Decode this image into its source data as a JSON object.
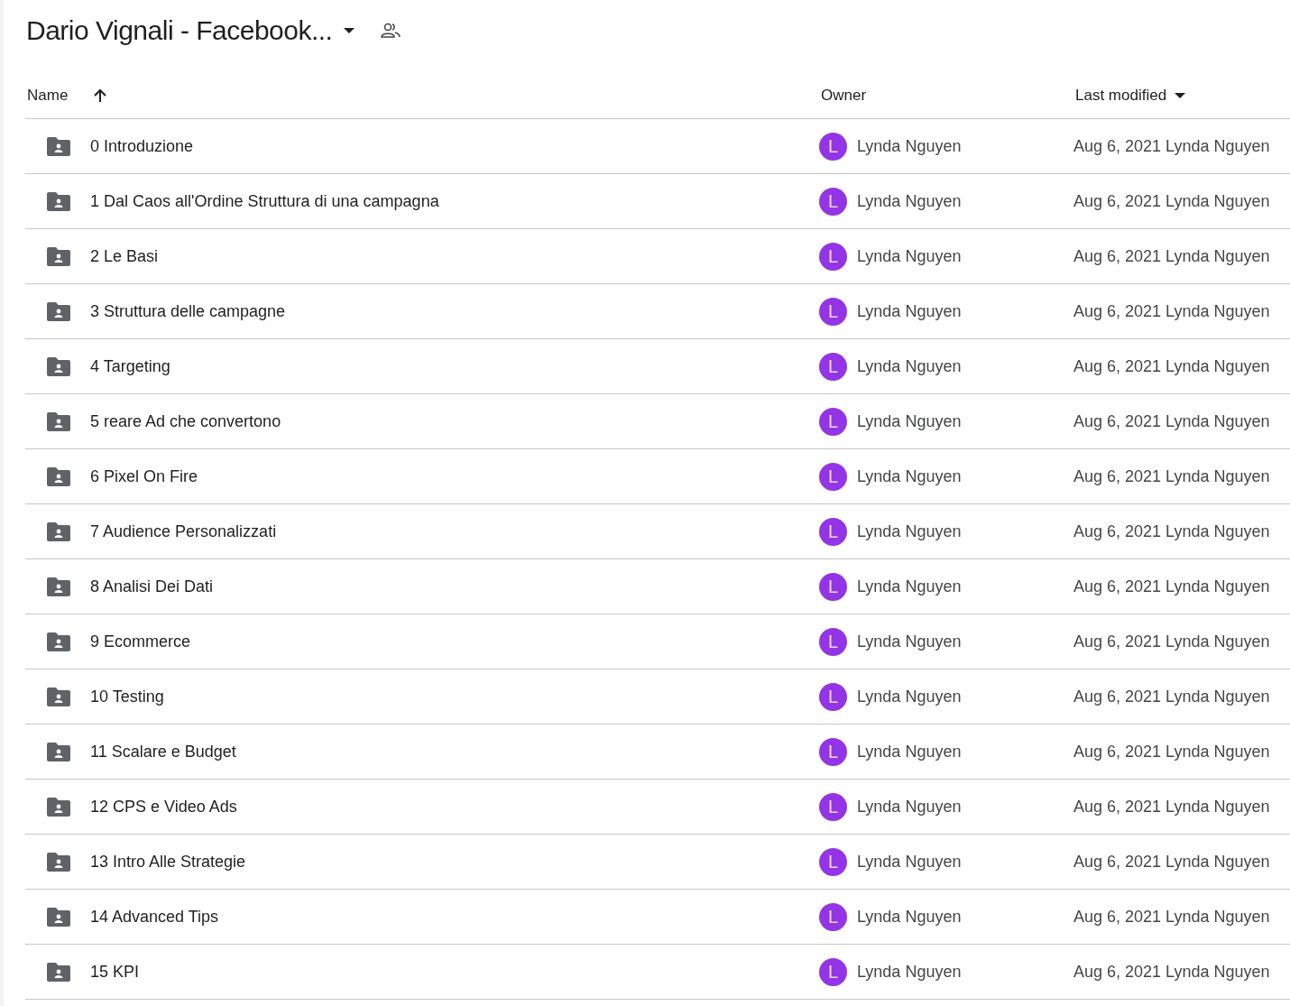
{
  "header": {
    "title": "Dario Vignali - Facebook..."
  },
  "table": {
    "columns": [
      {
        "label": "Name",
        "kind": "ascending"
      },
      {
        "label": "Owner",
        "kind": "plain"
      },
      {
        "label": "Last modified",
        "kind": "descending"
      }
    ],
    "rows": [
      {
        "name": "0 Introduzione",
        "owner_initial": "L",
        "owner": "Lynda Nguyen",
        "modified": "Aug 6, 2021 Lynda Nguyen"
      },
      {
        "name": "1 Dal Caos all'Ordine Struttura di una campagna",
        "owner_initial": "L",
        "owner": "Lynda Nguyen",
        "modified": "Aug 6, 2021 Lynda Nguyen"
      },
      {
        "name": "2 Le Basi",
        "owner_initial": "L",
        "owner": "Lynda Nguyen",
        "modified": "Aug 6, 2021 Lynda Nguyen"
      },
      {
        "name": "3 Struttura delle campagne",
        "owner_initial": "L",
        "owner": "Lynda Nguyen",
        "modified": "Aug 6, 2021 Lynda Nguyen"
      },
      {
        "name": "4 Targeting",
        "owner_initial": "L",
        "owner": "Lynda Nguyen",
        "modified": "Aug 6, 2021 Lynda Nguyen"
      },
      {
        "name": "5 reare Ad che convertono",
        "owner_initial": "L",
        "owner": "Lynda Nguyen",
        "modified": "Aug 6, 2021 Lynda Nguyen"
      },
      {
        "name": "6 Pixel On Fire",
        "owner_initial": "L",
        "owner": "Lynda Nguyen",
        "modified": "Aug 6, 2021 Lynda Nguyen"
      },
      {
        "name": "7 Audience Personalizzati",
        "owner_initial": "L",
        "owner": "Lynda Nguyen",
        "modified": "Aug 6, 2021 Lynda Nguyen"
      },
      {
        "name": "8 Analisi Dei Dati",
        "owner_initial": "L",
        "owner": "Lynda Nguyen",
        "modified": "Aug 6, 2021 Lynda Nguyen"
      },
      {
        "name": "9 Ecommerce",
        "owner_initial": "L",
        "owner": "Lynda Nguyen",
        "modified": "Aug 6, 2021 Lynda Nguyen"
      },
      {
        "name": "10 Testing",
        "owner_initial": "L",
        "owner": "Lynda Nguyen",
        "modified": "Aug 6, 2021 Lynda Nguyen"
      },
      {
        "name": "11 Scalare e Budget",
        "owner_initial": "L",
        "owner": "Lynda Nguyen",
        "modified": "Aug 6, 2021 Lynda Nguyen"
      },
      {
        "name": "12 CPS e Video Ads",
        "owner_initial": "L",
        "owner": "Lynda Nguyen",
        "modified": "Aug 6, 2021 Lynda Nguyen"
      },
      {
        "name": "13 Intro Alle Strategie",
        "owner_initial": "L",
        "owner": "Lynda Nguyen",
        "modified": "Aug 6, 2021 Lynda Nguyen"
      },
      {
        "name": "14 Advanced Tips",
        "owner_initial": "L",
        "owner": "Lynda Nguyen",
        "modified": "Aug 6, 2021 Lynda Nguyen"
      },
      {
        "name": "15 KPI",
        "owner_initial": "L",
        "owner": "Lynda Nguyen",
        "modified": "Aug 6, 2021 Lynda Nguyen"
      }
    ]
  }
}
